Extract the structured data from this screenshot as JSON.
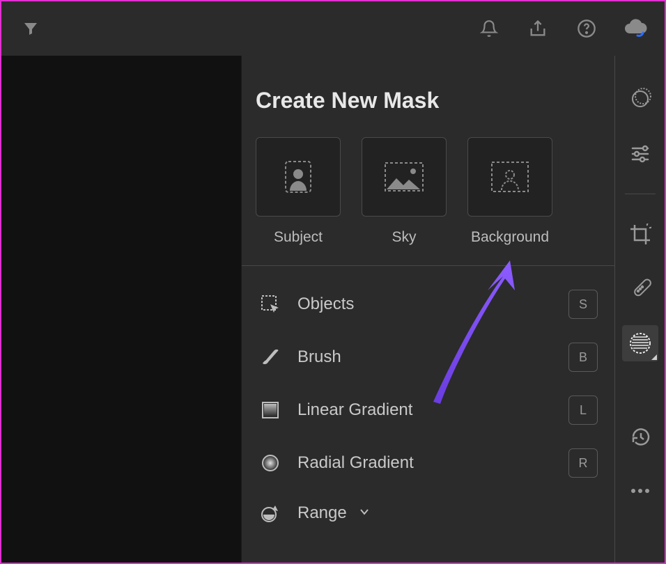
{
  "topbar": {
    "filter_icon": "funnel-icon",
    "notify_icon": "bell-icon",
    "share_icon": "share-icon",
    "help_icon": "help-icon",
    "cloud_icon": "cloud-sync-icon"
  },
  "panel": {
    "title": "Create New Mask",
    "cards": [
      {
        "key": "subject",
        "label": "Subject",
        "icon": "subject-icon"
      },
      {
        "key": "sky",
        "label": "Sky",
        "icon": "sky-icon"
      },
      {
        "key": "background",
        "label": "Background",
        "icon": "background-icon"
      }
    ],
    "tools": [
      {
        "key": "objects",
        "label": "Objects",
        "shortcut": "S",
        "icon": "objects-icon"
      },
      {
        "key": "brush",
        "label": "Brush",
        "shortcut": "B",
        "icon": "brush-icon"
      },
      {
        "key": "linear",
        "label": "Linear Gradient",
        "shortcut": "L",
        "icon": "linear-gradient-icon"
      },
      {
        "key": "radial",
        "label": "Radial Gradient",
        "shortcut": "R",
        "icon": "radial-gradient-icon"
      },
      {
        "key": "range",
        "label": "Range",
        "shortcut": "",
        "icon": "range-icon",
        "expandable": true
      }
    ]
  },
  "rail": {
    "edit": "edit-icon",
    "sliders": "sliders-icon",
    "crop": "crop-icon",
    "heal": "healing-icon",
    "mask": "masking-icon",
    "history": "history-icon",
    "more": "more-icon"
  },
  "colors": {
    "accent_arrow": "#7a4af0",
    "cloud_accent": "#2d6cff"
  }
}
